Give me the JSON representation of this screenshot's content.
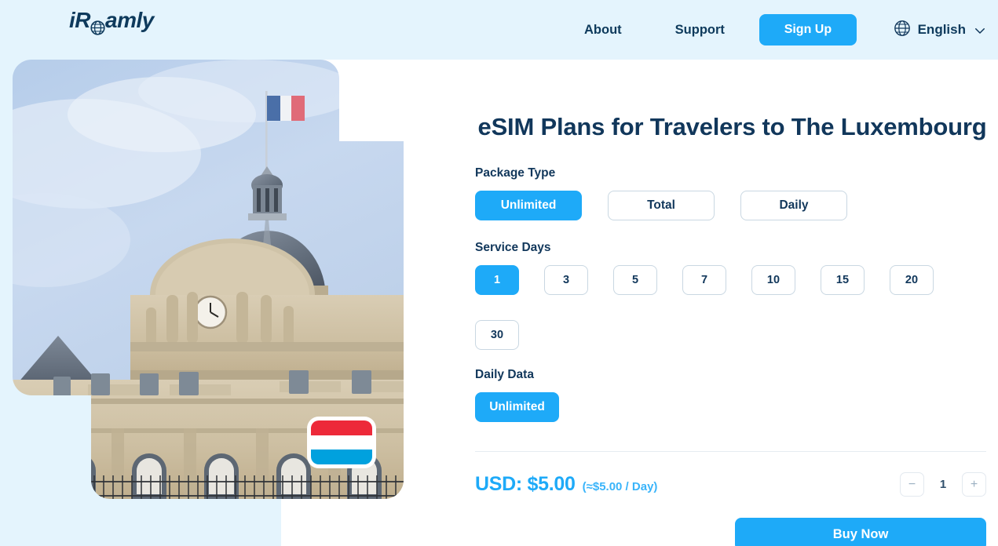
{
  "brand": {
    "name_before": "iR",
    "name_after": "amly",
    "logo_icon": "globe-icon",
    "logo_color": "#0e3a5c"
  },
  "nav": {
    "links": [
      {
        "label": "About",
        "name": "nav-link-about"
      },
      {
        "label": "Support",
        "name": "nav-link-support"
      }
    ],
    "signup_label": "Sign Up",
    "language": {
      "icon": "globe-icon",
      "label": "English",
      "chevron": "chevron-down-icon"
    },
    "accent_color": "#1eaaf8"
  },
  "hero": {
    "photo_alt": "Luxembourg Palace facade with dome and French flag",
    "overlay_flag": "luxembourg-flag",
    "flag_stripes": [
      "#ed2939",
      "#ffffff",
      "#00a1de"
    ],
    "in_photo_flag": "france-flag"
  },
  "main": {
    "title": "eSIM Plans for Travelers to The Luxembourg",
    "package_type": {
      "label": "Package Type",
      "options": [
        {
          "label": "Unlimited",
          "selected": true
        },
        {
          "label": "Total",
          "selected": false
        },
        {
          "label": "Daily",
          "selected": false
        }
      ]
    },
    "service_days": {
      "label": "Service Days",
      "options": [
        {
          "label": "1",
          "selected": true
        },
        {
          "label": "3",
          "selected": false
        },
        {
          "label": "5",
          "selected": false
        },
        {
          "label": "7",
          "selected": false
        },
        {
          "label": "10",
          "selected": false
        },
        {
          "label": "15",
          "selected": false
        },
        {
          "label": "20",
          "selected": false
        },
        {
          "label": "30",
          "selected": false
        }
      ]
    },
    "daily_data": {
      "label": "Daily Data",
      "options": [
        {
          "label": "Unlimited",
          "selected": true
        }
      ]
    },
    "price": {
      "main": "USD: $5.00",
      "per_day": "(≈$5.00 / Day)",
      "color": "#1eaaf8"
    },
    "quantity": {
      "decrement": "−",
      "value": "1",
      "increment": "+"
    },
    "buy_label": "Buy Now"
  },
  "colors": {
    "page_bg": "#ffffff",
    "band_bg": "#e4f4fd",
    "accent": "#1eaaf8",
    "ink": "#11375b"
  }
}
